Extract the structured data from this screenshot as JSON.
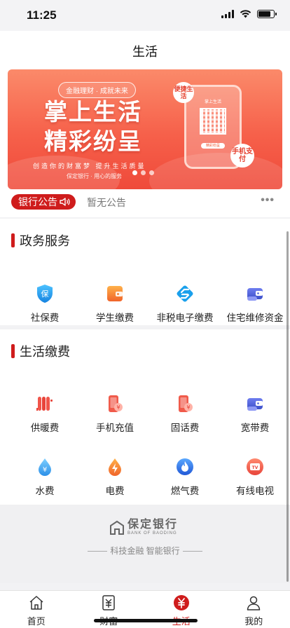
{
  "status_bar": {
    "time": "11:25"
  },
  "nav": {
    "title": "生活"
  },
  "banner": {
    "tag": "金融理财 · 成就未来",
    "headline_line1": "掌上生活",
    "headline_line2": "精彩纷呈",
    "slogan": "创造你的财富梦  提升生活质量",
    "subtext": "保定银行 · 用心的服务",
    "badge_left": "便捷生活",
    "badge_right": "手机支付",
    "phone_title": "掌上生活",
    "phone_button": "精彩纷呈",
    "slide_count": 3,
    "active_slide": 1
  },
  "notice": {
    "tag_label": "银行公告",
    "text": "暂无公告",
    "more_label": "•••"
  },
  "government_services": {
    "title": "政务服务",
    "items": [
      {
        "label": "社保费",
        "icon": "social-security-shield-icon",
        "color": "#1a9be8"
      },
      {
        "label": "学生缴费",
        "icon": "student-wallet-icon",
        "color": "#f0792a"
      },
      {
        "label": "非税电子缴费",
        "icon": "nontax-payment-icon",
        "color": "#1a9be8"
      },
      {
        "label": "住宅维修资金",
        "icon": "housing-fund-wallet-icon",
        "color": "#4a5fd6"
      }
    ]
  },
  "life_payments": {
    "title": "生活缴费",
    "items": [
      {
        "label": "供暖费",
        "icon": "radiator-icon",
        "color": "#e8443a"
      },
      {
        "label": "手机充值",
        "icon": "mobile-recharge-icon",
        "color": "#e8443a"
      },
      {
        "label": "固话费",
        "icon": "landline-bill-icon",
        "color": "#e8443a"
      },
      {
        "label": "宽带费",
        "icon": "broadband-wallet-icon",
        "color": "#4a5fd6"
      },
      {
        "label": "水费",
        "icon": "water-drop-icon",
        "color": "#1a9be8"
      },
      {
        "label": "电费",
        "icon": "electricity-drop-icon",
        "color": "#f0792a"
      },
      {
        "label": "燃气费",
        "icon": "gas-flame-icon",
        "color": "#2b6fe0"
      },
      {
        "label": "有线电视",
        "icon": "cable-tv-icon",
        "color": "#e8443a"
      }
    ]
  },
  "brand": {
    "name": "保定银行",
    "english": "BANK OF BAODING",
    "slogan": "科技金融 智能银行"
  },
  "tab_bar": {
    "tabs": [
      {
        "label": "首页",
        "icon": "home-icon"
      },
      {
        "label": "财富",
        "icon": "wealth-icon"
      },
      {
        "label": "生活",
        "icon": "life-yuan-icon"
      },
      {
        "label": "我的",
        "icon": "profile-icon"
      }
    ],
    "active": "生活"
  },
  "colors": {
    "accent": "#cf1c1c",
    "banner_top": "#fb8a6a",
    "banner_bottom": "#ef4a3a"
  }
}
